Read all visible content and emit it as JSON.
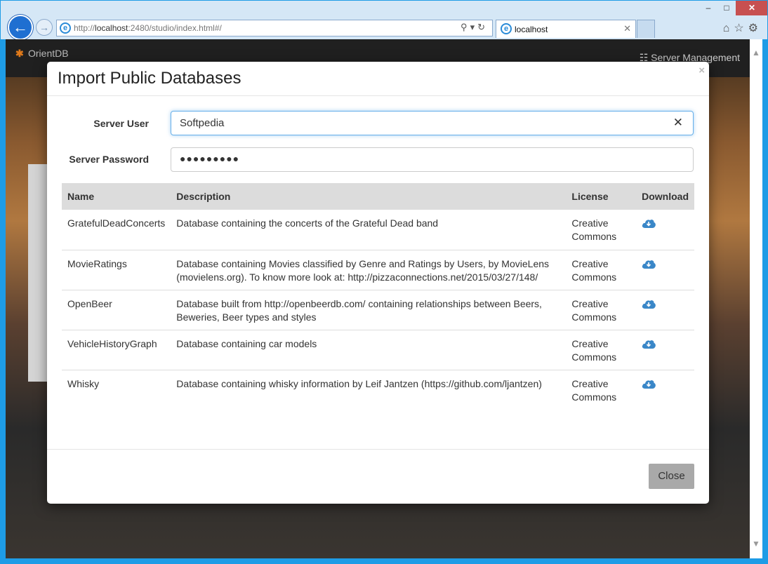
{
  "browser": {
    "url_prefix": "http://",
    "url_host": "localhost",
    "url_rest": ":2480/studio/index.html#/",
    "tab_title": "localhost",
    "minimize": "–",
    "maximize": "□",
    "close": "✕"
  },
  "app": {
    "logo_text": "OrientDB",
    "server_management": "Server Management"
  },
  "modal": {
    "title": "Import Public Databases",
    "close_x": "×",
    "server_user_label": "Server User",
    "server_user_value": "Softpedia",
    "server_password_label": "Server Password",
    "server_password_value": "●●●●●●●●●",
    "columns": [
      "Name",
      "Description",
      "License",
      "Download"
    ],
    "rows": [
      {
        "name": "GratefulDeadConcerts",
        "description": "Database containing the concerts of the Grateful Dead band",
        "license": "Creative Commons"
      },
      {
        "name": "MovieRatings",
        "description": "Database containing Movies classified by Genre and Ratings by Users, by MovieLens (movielens.org). To know more look at: http://pizzaconnections.net/2015/03/27/148/",
        "license": "Creative Commons"
      },
      {
        "name": "OpenBeer",
        "description": "Database built from http://openbeerdb.com/ containing relationships between Beers, Beweries, Beer types and styles",
        "license": "Creative Commons"
      },
      {
        "name": "VehicleHistoryGraph",
        "description": "Database containing car models",
        "license": "Creative Commons"
      },
      {
        "name": "Whisky",
        "description": "Database containing whisky information by Leif Jantzen (https://github.com/ljantzen)",
        "license": "Creative Commons"
      }
    ],
    "close_button": "Close"
  },
  "colors": {
    "accent": "#3a87c8",
    "close_button_bg": "#a9a9a9",
    "table_header_bg": "#dcdcdc"
  }
}
